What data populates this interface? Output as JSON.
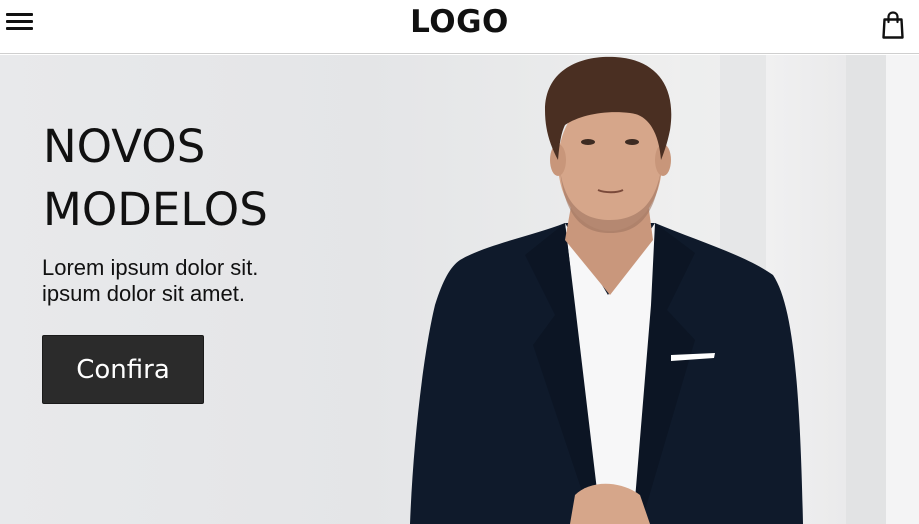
{
  "header": {
    "logo_text": "LOGO",
    "menu_icon": "hamburger-menu-icon",
    "bag_icon": "shopping-bag-icon"
  },
  "hero": {
    "title_line1": "NOVOS",
    "title_line2": "MODELOS",
    "text_line1": "Lorem ipsum dolor sit.",
    "text_line2": "ipsum dolor sit amet.",
    "cta_label": "Confira",
    "photo_description_icon": "man-in-suit-photo"
  },
  "colors": {
    "header_bg": "#ffffff",
    "hero_bg": "#e6e7e9",
    "text": "#111111",
    "cta_bg": "#2b2b2b",
    "cta_text": "#ffffff",
    "suit": "#0f1a2b"
  }
}
